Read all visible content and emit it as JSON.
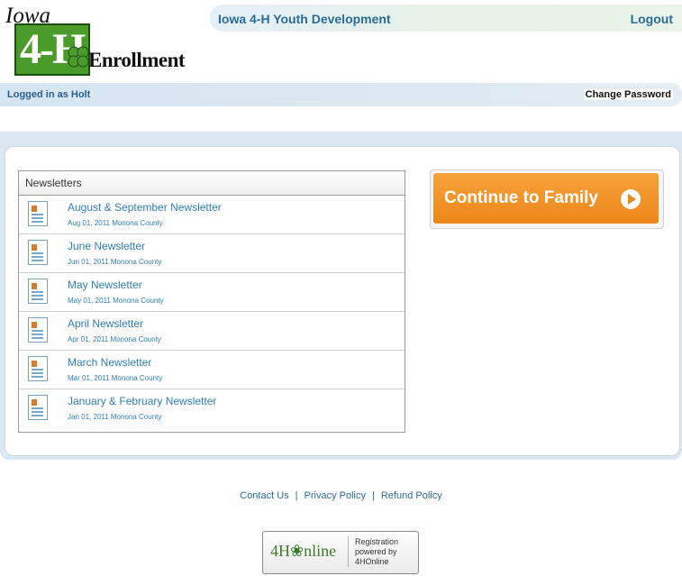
{
  "logo": {
    "state": "Iowa",
    "mark": "4-H",
    "product": "Enrollment"
  },
  "header": {
    "org_name": "Iowa 4-H Youth Development",
    "logout_label": "Logout"
  },
  "userbar": {
    "logged_in_text": "Logged in as Holt",
    "change_password_label": "Change Password"
  },
  "newsletters": {
    "heading": "Newsletters",
    "items": [
      {
        "title": "August & September Newsletter",
        "meta": "Aug 01, 2011 Monona County"
      },
      {
        "title": "June Newsletter",
        "meta": "Jun 01, 2011 Monona County"
      },
      {
        "title": "May Newsletter",
        "meta": "May 01, 2011 Monona County"
      },
      {
        "title": "April Newsletter",
        "meta": "Apr 01, 2011 Monona County"
      },
      {
        "title": "March Newsletter",
        "meta": "Mar 01, 2011 Monona County"
      },
      {
        "title": "January & February Newsletter",
        "meta": "Jan 01, 2011 Monona County"
      }
    ]
  },
  "cta": {
    "label": "Continue to Family"
  },
  "footer": {
    "contact": "Contact Us",
    "privacy": "Privacy Policy",
    "refund": "Refund Policy",
    "separator": "|"
  },
  "badge": {
    "brand": "4H❀nline",
    "line1": "Registration",
    "line2": "powered by",
    "line3": "4HOnline"
  },
  "colors": {
    "accent": "#2a6c97",
    "cta": "#ec8718",
    "brand_green": "#4b9b2b"
  }
}
